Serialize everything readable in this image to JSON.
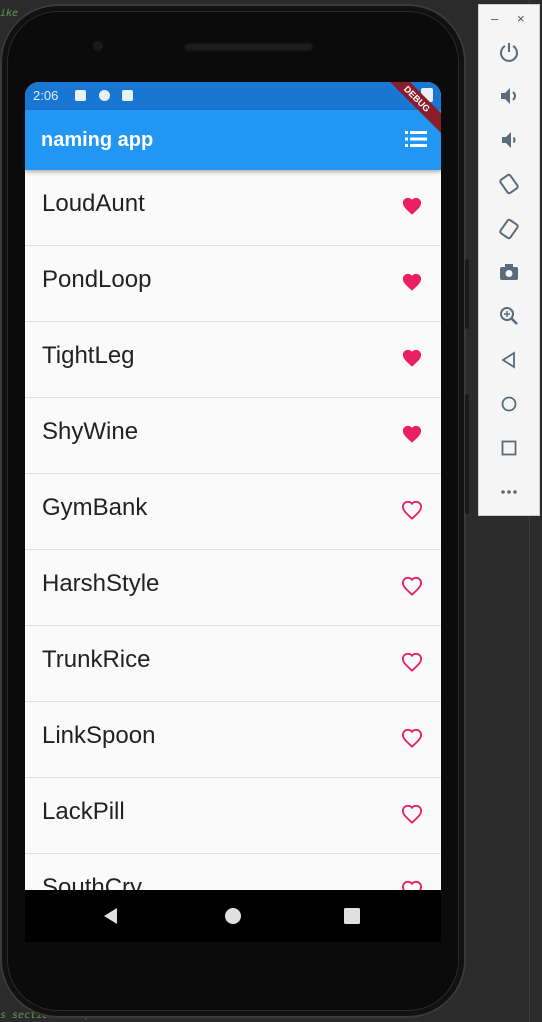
{
  "app": {
    "title": "naming app",
    "debug_label": "DEBUG"
  },
  "status_bar": {
    "time": "2:06"
  },
  "words": [
    {
      "label": "LoudAunt",
      "saved": true
    },
    {
      "label": "PondLoop",
      "saved": true
    },
    {
      "label": "TightLeg",
      "saved": true
    },
    {
      "label": "ShyWine",
      "saved": true
    },
    {
      "label": "GymBank",
      "saved": false
    },
    {
      "label": "HarshStyle",
      "saved": false
    },
    {
      "label": "TrunkRice",
      "saved": false
    },
    {
      "label": "LinkSpoon",
      "saved": false
    },
    {
      "label": "LackPill",
      "saved": false
    },
    {
      "label": "SouthCry",
      "saved": false
    }
  ],
  "colors": {
    "app_bar": "#2196f3",
    "status_bar": "#1976d2",
    "heart": "#e91e63"
  },
  "emulator_toolbar": {
    "minimize": "–",
    "close": "×",
    "buttons": [
      "power-icon",
      "volume-up-icon",
      "volume-down-icon",
      "rotate-left-icon",
      "rotate-right-icon",
      "camera-icon",
      "zoom-icon",
      "back-icon",
      "home-icon",
      "overview-icon",
      "more-icon"
    ]
  },
  "ide": {
    "snippet_top": "ike",
    "snippet_bottom": "s section here)"
  }
}
